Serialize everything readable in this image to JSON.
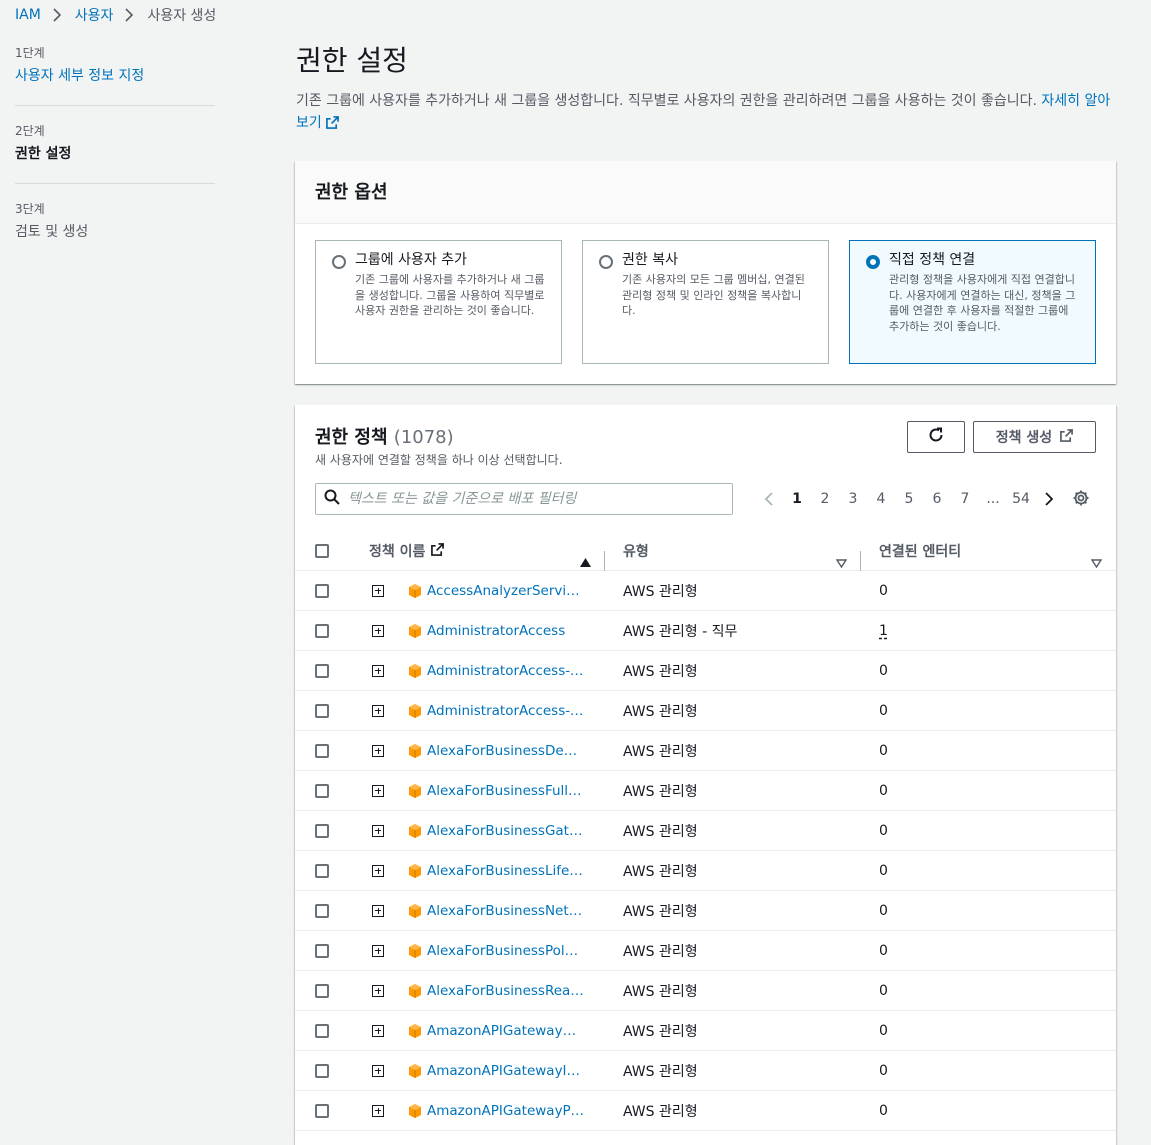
{
  "breadcrumb": {
    "items": [
      "IAM",
      "사용자"
    ],
    "current": "사용자 생성"
  },
  "steps": [
    {
      "num": "1단계",
      "label": "사용자 세부 정보 지정"
    },
    {
      "num": "2단계",
      "label": "권한 설정"
    },
    {
      "num": "3단계",
      "label": "검토 및 생성"
    }
  ],
  "page": {
    "title": "권한 설정",
    "description": "기존 그룹에 사용자를 추가하거나 새 그룹을 생성합니다. 직무별로 사용자의 권한을 관리하려면 그룹을 사용하는 것이 좋습니다.",
    "learn_more": "자세히 알아보기"
  },
  "options": {
    "header": "권한 옵션",
    "tiles": [
      {
        "title": "그룹에 사용자 추가",
        "desc": "기존 그룹에 사용자를 추가하거나 새 그룹을 생성합니다. 그룹을 사용하여 직무별로 사용자 권한을 관리하는 것이 좋습니다.",
        "selected": false
      },
      {
        "title": "권한 복사",
        "desc": "기존 사용자의 모든 그룹 멤버십, 연결된 관리형 정책 및 인라인 정책을 복사합니다.",
        "selected": false
      },
      {
        "title": "직접 정책 연결",
        "desc": "관리형 정책을 사용자에게 직접 연결합니다. 사용자에게 연결하는 대신, 정책을 그룹에 연결한 후 사용자를 적절한 그룹에 추가하는 것이 좋습니다.",
        "selected": true
      }
    ]
  },
  "policies": {
    "title": "권한 정책",
    "count": "(1078)",
    "subtitle": "새 사용자에 연결할 정책을 하나 이상 선택합니다.",
    "create_button": "정책 생성",
    "search_placeholder": "텍스트 또는 값을 기준으로 배포 필터링",
    "pagination": [
      "1",
      "2",
      "3",
      "4",
      "5",
      "6",
      "7",
      "...",
      "54"
    ],
    "columns": {
      "name": "정책 이름",
      "type": "유형",
      "entities": "연결된 엔터티"
    },
    "rows": [
      {
        "name": "AccessAnalyzerServiceRolePolicy",
        "type": "AWS 관리형",
        "entities": "0"
      },
      {
        "name": "AdministratorAccess",
        "type": "AWS 관리형 - 직무",
        "entities": "1"
      },
      {
        "name": "AdministratorAccess-Amplify",
        "type": "AWS 관리형",
        "entities": "0"
      },
      {
        "name": "AdministratorAccess-AWSElasticBeanstalk",
        "type": "AWS 관리형",
        "entities": "0"
      },
      {
        "name": "AlexaForBusinessDeviceSetup",
        "type": "AWS 관리형",
        "entities": "0"
      },
      {
        "name": "AlexaForBusinessFullAccess",
        "type": "AWS 관리형",
        "entities": "0"
      },
      {
        "name": "AlexaForBusinessGatewayExecution",
        "type": "AWS 관리형",
        "entities": "0"
      },
      {
        "name": "AlexaForBusinessLifesizeDelegatedAccessPolicy",
        "type": "AWS 관리형",
        "entities": "0"
      },
      {
        "name": "AlexaForBusinessNetworkProfileServicePolicy",
        "type": "AWS 관리형",
        "entities": "0"
      },
      {
        "name": "AlexaForBusinessPolyDelegatedAccessPolicy",
        "type": "AWS 관리형",
        "entities": "0"
      },
      {
        "name": "AlexaForBusinessReadOnlyAccess",
        "type": "AWS 관리형",
        "entities": "0"
      },
      {
        "name": "AmazonAPIGatewayAdministrator",
        "type": "AWS 관리형",
        "entities": "0"
      },
      {
        "name": "AmazonAPIGatewayInvokeFullAccess",
        "type": "AWS 관리형",
        "entities": "0"
      },
      {
        "name": "AmazonAPIGatewayPushToCloudWatchLogs",
        "type": "AWS 관리형",
        "entities": "0"
      }
    ]
  }
}
